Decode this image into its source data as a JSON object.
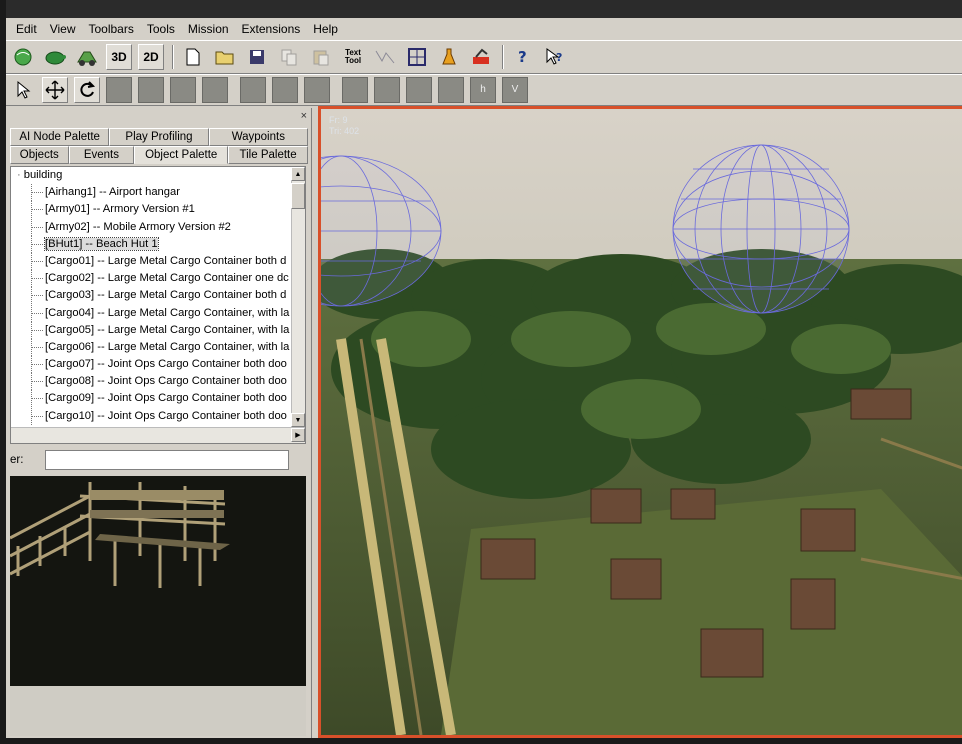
{
  "menu": [
    "Edit",
    "View",
    "Toolbars",
    "Tools",
    "Mission",
    "Extensions",
    "Help"
  ],
  "toolbar1": {
    "btn_3d": "3D",
    "btn_2d": "2D",
    "text_tool": "Text\nTool"
  },
  "toolbar2": {
    "tiles": [
      "",
      "",
      "",
      "",
      "",
      "",
      "",
      "",
      "",
      "",
      "",
      "",
      "",
      "h",
      "V"
    ]
  },
  "panel": {
    "close": "×",
    "tabs_row1": [
      "AI Node Palette",
      "Play Profiling",
      "Waypoints"
    ],
    "tabs_row2": [
      "Objects",
      "Events",
      "Object Palette",
      "Tile Palette"
    ],
    "active_tab": "Object Palette",
    "tree_root": "building",
    "tree_items": [
      "[Airhang1] -- Airport hangar",
      "[Army01] -- Armory Version #1",
      "[Army02] -- Mobile Armory Version #2",
      "[BHut1] -- Beach Hut 1",
      "[Cargo01] -- Large Metal Cargo Container both d",
      "[Cargo02] -- Large Metal Cargo Container one dc",
      "[Cargo03] -- Large Metal Cargo Container both d",
      "[Cargo04] -- Large Metal Cargo Container, with la",
      "[Cargo05] -- Large Metal Cargo Container, with la",
      "[Cargo06] -- Large Metal Cargo Container, with la",
      "[Cargo07] -- Joint Ops Cargo Container both doo",
      "[Cargo08] -- Joint Ops Cargo Container both doo",
      "[Cargo09] -- Joint Ops Cargo Container both doo",
      "[Cargo10] -- Joint Ops Cargo Container both doo"
    ],
    "selected_item": 3,
    "filter_label": "er:",
    "filter_value": ""
  },
  "viewport": {
    "hud_lines": [
      "Fr: 9",
      "Tri: 402",
      "",
      "",
      ""
    ]
  },
  "colors": {
    "viewport_border": "#d8502a",
    "dome_wire": "#6a6adc"
  }
}
